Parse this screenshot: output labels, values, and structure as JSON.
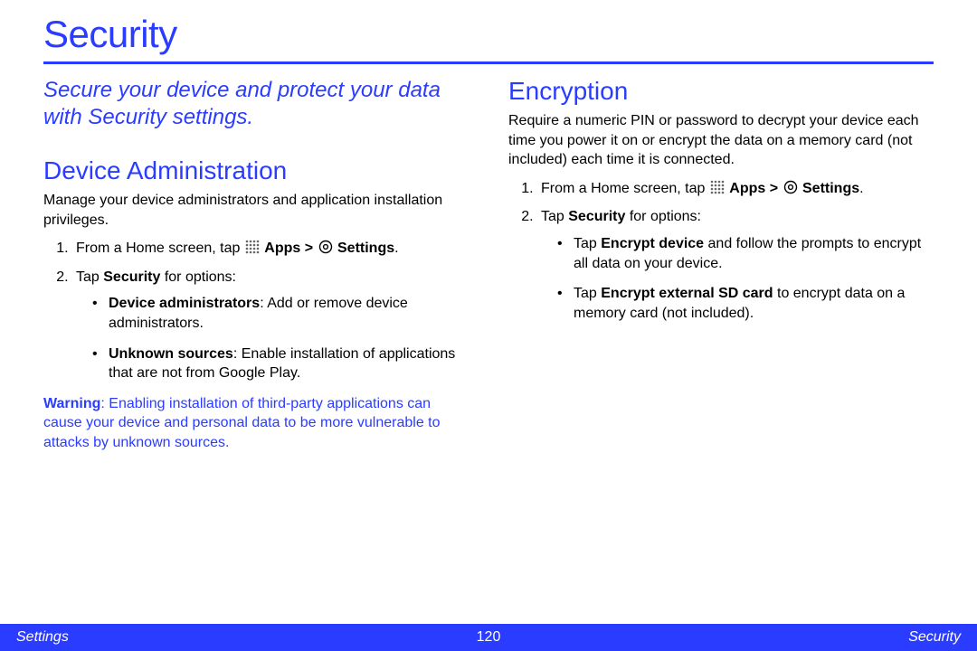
{
  "title": "Security",
  "subtitle": "Secure your device and protect your data with Security settings.",
  "labels": {
    "apps": "Apps",
    "settings": "Settings",
    "gt": ">"
  },
  "sections": {
    "device_admin": {
      "heading": "Device Administration",
      "intro": "Manage your device administrators and application installation privileges.",
      "step1_prefix": "From a Home screen, tap ",
      "step2": "Tap ",
      "step2_bold": "Security",
      "step2_suffix": " for options:",
      "bullets": [
        {
          "bold": "Device administrators",
          "rest": ": Add or remove device administrators."
        },
        {
          "bold": "Unknown sources",
          "rest": ": Enable installation of applications that are not from Google Play."
        }
      ],
      "warning_bold": "Warning",
      "warning_rest": ": Enabling installation of third-party applications can cause your device and personal data to be more vulnerable to attacks by unknown sources."
    },
    "encryption": {
      "heading": "Encryption",
      "intro": "Require a numeric PIN or password to decrypt your device each time you power it on or encrypt the data on a memory card (not included) each time it is connected.",
      "step1_prefix": "From a Home screen, tap ",
      "step2": "Tap ",
      "step2_bold": "Security",
      "step2_suffix": " for options:",
      "bullets": [
        {
          "prefix": "Tap ",
          "bold": "Encrypt device",
          "rest": " and follow the prompts to encrypt all data on your device."
        },
        {
          "prefix": "Tap ",
          "bold": "Encrypt external SD card",
          "rest": " to encrypt data on a memory card (not included)."
        }
      ]
    }
  },
  "footer": {
    "left": "Settings",
    "center": "120",
    "right": "Security"
  }
}
